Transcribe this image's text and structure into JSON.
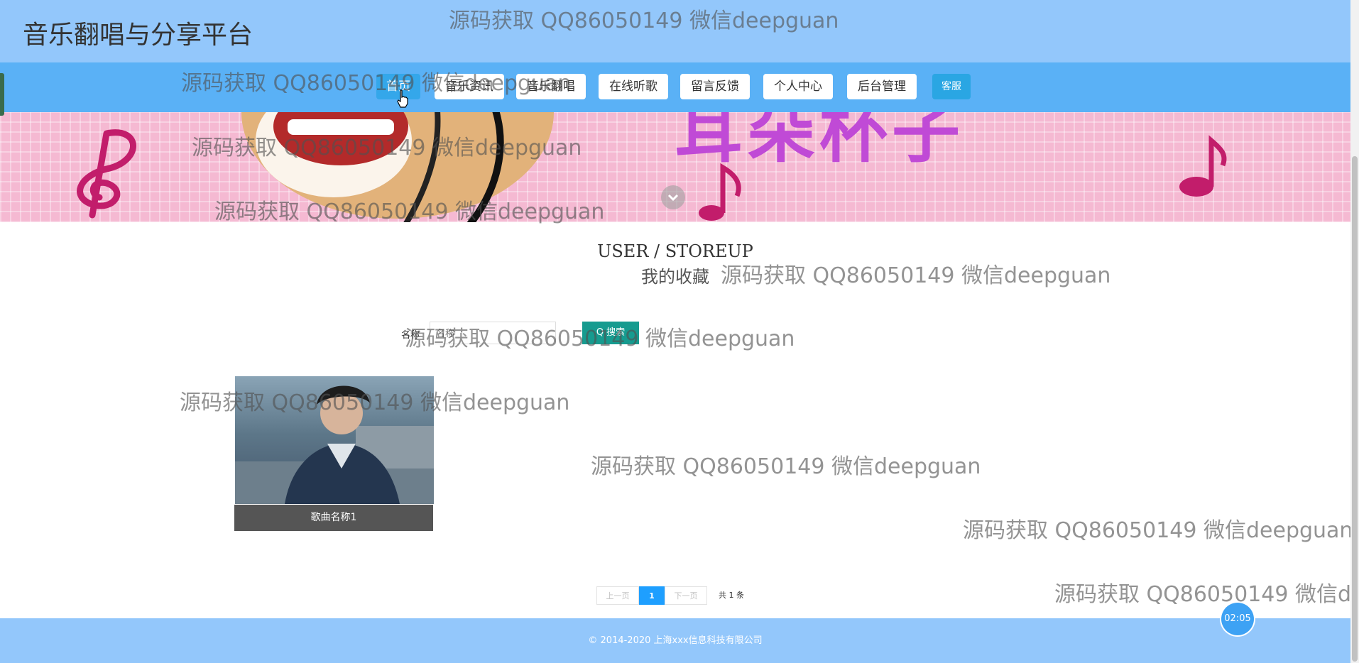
{
  "header": {
    "title": "音乐翻唱与分享平台"
  },
  "nav": {
    "items": [
      {
        "label": "首页"
      },
      {
        "label": "音乐资讯"
      },
      {
        "label": "音乐翻唱"
      },
      {
        "label": "在线听歌"
      },
      {
        "label": "留言反馈"
      },
      {
        "label": "个人中心"
      },
      {
        "label": "后台管理"
      }
    ],
    "service_label": "客服"
  },
  "section": {
    "title_en": "USER / STOREUP",
    "title_cn": "我的收藏"
  },
  "search": {
    "label": "名称",
    "placeholder": "名称",
    "button_label": "Q 搜索"
  },
  "items": [
    {
      "name": "歌曲名称1"
    }
  ],
  "pagination": {
    "prev_label": "上一页",
    "current_page": "1",
    "next_label": "下一页",
    "total_text": "共 1 条"
  },
  "footer": {
    "copyright": "© 2014-2020 上海xxx信息科技有限公司"
  },
  "timer": {
    "text": "02:05"
  },
  "watermark_text": "源码获取 QQ86050149 微信deepguan",
  "colors": {
    "header_bg": "#93c7fb",
    "nav_bg": "#5ab1f6",
    "search_button": "#169b8f",
    "pager_active": "#1e9fff"
  }
}
